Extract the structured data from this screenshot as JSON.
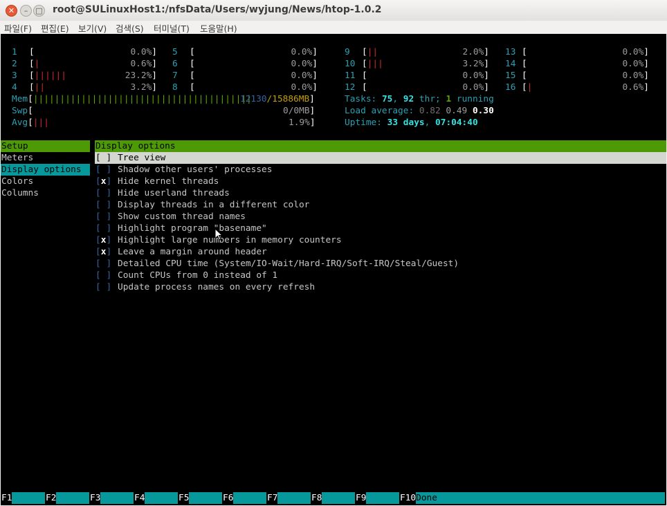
{
  "window": {
    "title": "root@SULinuxHost1:/nfsData/Users/wyjung/News/htop-1.0.2"
  },
  "menu": [
    "파일(F)",
    "편집(E)",
    "보기(V)",
    "검색(S)",
    "터미널(T)",
    "도움말(H)"
  ],
  "cpus": [
    {
      "id": "1",
      "bars": "",
      "pct": "0.0%"
    },
    {
      "id": "2",
      "bars": "|",
      "pct": "0.6%"
    },
    {
      "id": "3",
      "bars": "||||||",
      "pct": "23.2%"
    },
    {
      "id": "4",
      "bars": "||",
      "pct": "3.2%"
    },
    {
      "id": "5",
      "bars": "",
      "pct": "0.0%"
    },
    {
      "id": "6",
      "bars": "",
      "pct": "0.0%"
    },
    {
      "id": "7",
      "bars": "",
      "pct": "0.0%"
    },
    {
      "id": "8",
      "bars": "",
      "pct": "0.0%"
    },
    {
      "id": "9",
      "bars": "||",
      "pct": "2.0%"
    },
    {
      "id": "10",
      "bars": "|||",
      "pct": "3.2%"
    },
    {
      "id": "11",
      "bars": "",
      "pct": "0.0%"
    },
    {
      "id": "12",
      "bars": "",
      "pct": "0.0%"
    },
    {
      "id": "13",
      "bars": "",
      "pct": "0.0%"
    },
    {
      "id": "14",
      "bars": "",
      "pct": "0.0%"
    },
    {
      "id": "15",
      "bars": "",
      "pct": "0.0%"
    },
    {
      "id": "16",
      "bars": "|",
      "pct": "0.6%"
    }
  ],
  "mem": {
    "label": "Mem",
    "bars": "|||||||||||||||||||||||||||||||||||||||||",
    "used": "12130",
    "total": "/15886MB"
  },
  "swp": {
    "label": "Swp",
    "value": "0/0MB"
  },
  "avg": {
    "label": "Avg",
    "bars": "|||",
    "value": "1.9%"
  },
  "tasks": {
    "label": "Tasks: ",
    "count": "75",
    "sep": ", ",
    "threads": "92",
    "thr_label": " thr; ",
    "running": "1",
    "running_label": " running"
  },
  "load": {
    "label": "Load average: ",
    "v1": "0.82",
    "v2": "0.49",
    "v3": "0.30"
  },
  "uptime": {
    "label": "Uptime: ",
    "days": "33",
    "days_label": "days",
    "sep": ", ",
    "time": "07:04:40"
  },
  "setup_menu": {
    "header": "Setup",
    "items": [
      "Meters",
      "Display options",
      "Colors",
      "Columns"
    ],
    "selected": "Display options"
  },
  "panel": {
    "header": "Display options",
    "options": [
      {
        "checked": " ",
        "label": "Tree view"
      },
      {
        "checked": " ",
        "label": "Shadow other users' processes"
      },
      {
        "checked": "x",
        "label": "Hide kernel threads"
      },
      {
        "checked": " ",
        "label": "Hide userland threads"
      },
      {
        "checked": " ",
        "label": "Display threads in a different color"
      },
      {
        "checked": " ",
        "label": "Show custom thread names"
      },
      {
        "checked": " ",
        "label": "Highlight program \"basename\""
      },
      {
        "checked": "x",
        "label": "Highlight large numbers in memory counters"
      },
      {
        "checked": "x",
        "label": "Leave a margin around header"
      },
      {
        "checked": " ",
        "label": "Detailed CPU time (System/IO-Wait/Hard-IRQ/Soft-IRQ/Steal/Guest)"
      },
      {
        "checked": " ",
        "label": "Count CPUs from 0 instead of 1"
      },
      {
        "checked": " ",
        "label": "Update process names on every refresh"
      }
    ]
  },
  "fkeys": [
    {
      "key": "F1",
      "label": ""
    },
    {
      "key": "F2",
      "label": ""
    },
    {
      "key": "F3",
      "label": ""
    },
    {
      "key": "F4",
      "label": ""
    },
    {
      "key": "F5",
      "label": ""
    },
    {
      "key": "F6",
      "label": ""
    },
    {
      "key": "F7",
      "label": ""
    },
    {
      "key": "F8",
      "label": ""
    },
    {
      "key": "F9",
      "label": ""
    },
    {
      "key": "F10",
      "label": "Done"
    }
  ]
}
